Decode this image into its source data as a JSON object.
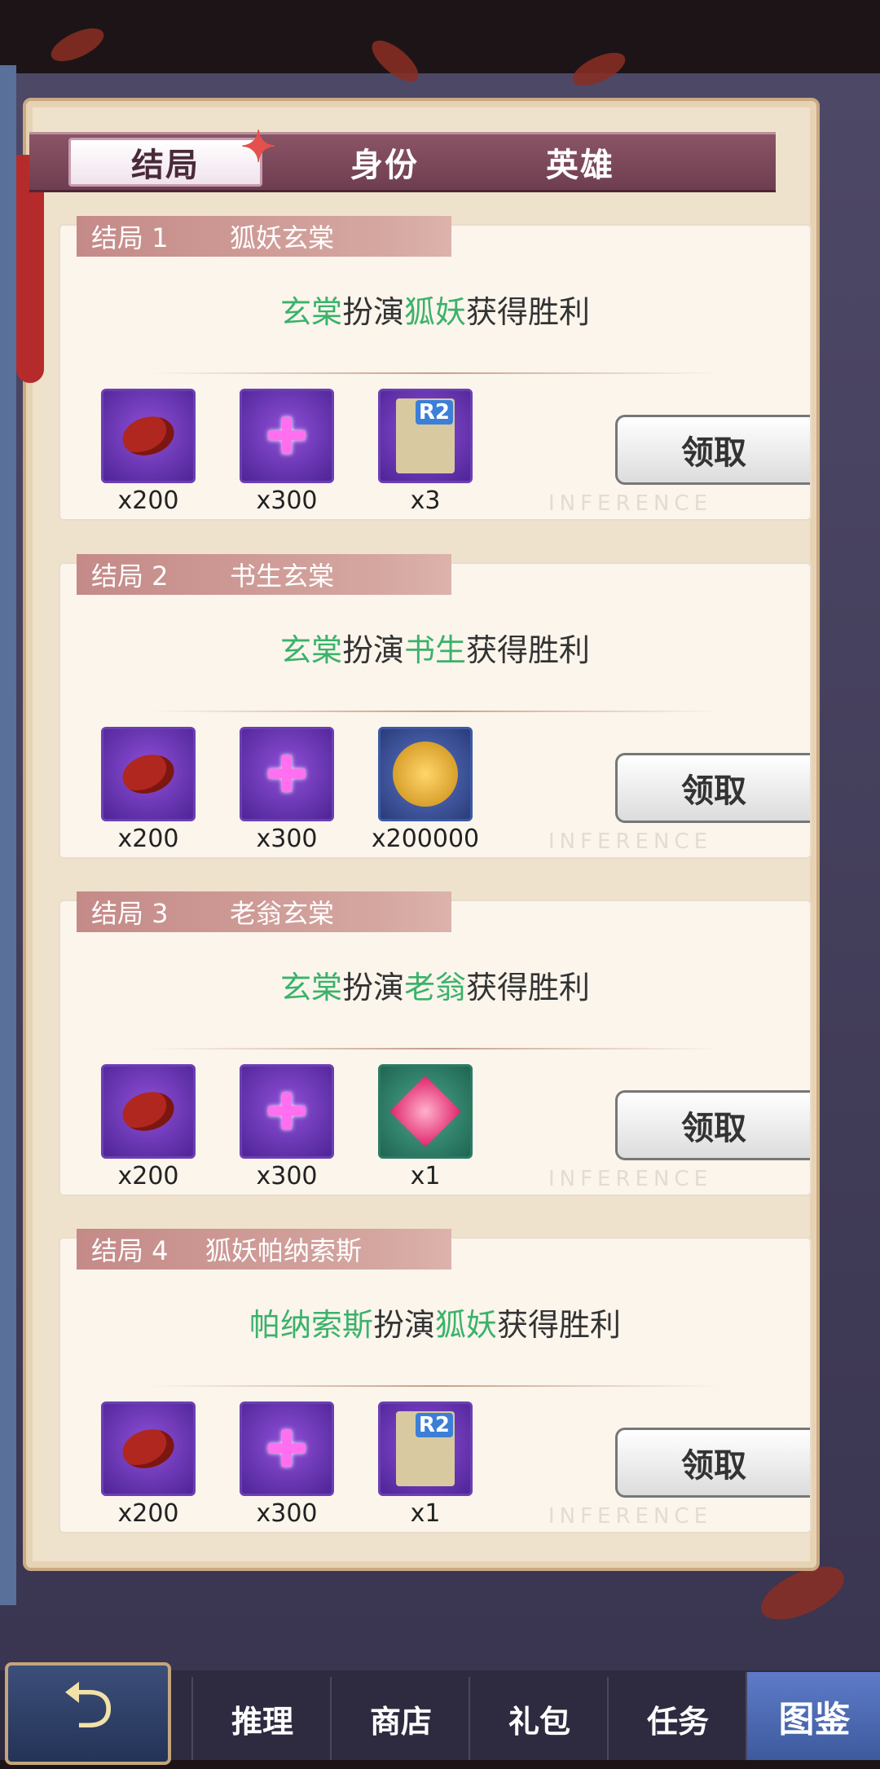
{
  "tabs": [
    {
      "label": "结局",
      "active": true
    },
    {
      "label": "身份",
      "active": false
    },
    {
      "label": "英雄",
      "active": false
    }
  ],
  "endings": [
    {
      "index": "结局  1",
      "name": "狐妖玄棠",
      "desc": {
        "actor": "玄棠",
        "verb": "扮演",
        "role": "狐妖",
        "result": "获得胜利"
      },
      "rewards": [
        {
          "icon": "bean-icon",
          "qty": "x200"
        },
        {
          "icon": "puzzle-icon",
          "qty": "x300"
        },
        {
          "icon": "r2-card-icon",
          "qty": "x3"
        }
      ],
      "claim": "领取"
    },
    {
      "index": "结局  2",
      "name": "书生玄棠",
      "desc": {
        "actor": "玄棠",
        "verb": "扮演",
        "role": "书生",
        "result": "获得胜利"
      },
      "rewards": [
        {
          "icon": "bean-icon",
          "qty": "x200"
        },
        {
          "icon": "puzzle-icon",
          "qty": "x300"
        },
        {
          "icon": "gold-coin-icon",
          "qty": "x200000"
        }
      ],
      "claim": "领取"
    },
    {
      "index": "结局  3",
      "name": "老翁玄棠",
      "desc": {
        "actor": "玄棠",
        "verb": "扮演",
        "role": "老翁",
        "result": "获得胜利"
      },
      "rewards": [
        {
          "icon": "bean-icon",
          "qty": "x200"
        },
        {
          "icon": "puzzle-icon",
          "qty": "x300"
        },
        {
          "icon": "gem-icon",
          "qty": "x1"
        }
      ],
      "claim": "领取"
    },
    {
      "index": "结局  4",
      "name": "狐妖帕纳索斯",
      "desc": {
        "actor": "帕纳索斯",
        "verb": "扮演",
        "role": "狐妖",
        "result": "获得胜利"
      },
      "rewards": [
        {
          "icon": "bean-icon",
          "qty": "x200"
        },
        {
          "icon": "puzzle-icon",
          "qty": "x300"
        },
        {
          "icon": "r2-card-icon",
          "qty": "x1"
        }
      ],
      "claim": "领取"
    }
  ],
  "r2_badge": "R2",
  "watermark": "INFERENCE",
  "bottom_nav": [
    {
      "label": "推理"
    },
    {
      "label": "商店"
    },
    {
      "label": "礼包"
    },
    {
      "label": "任务"
    },
    {
      "label": "图鉴",
      "active": true
    }
  ],
  "colors": {
    "highlight": "#3bb26a",
    "tab_bar": "#7a4a5c",
    "panel": "#efe2cc"
  }
}
